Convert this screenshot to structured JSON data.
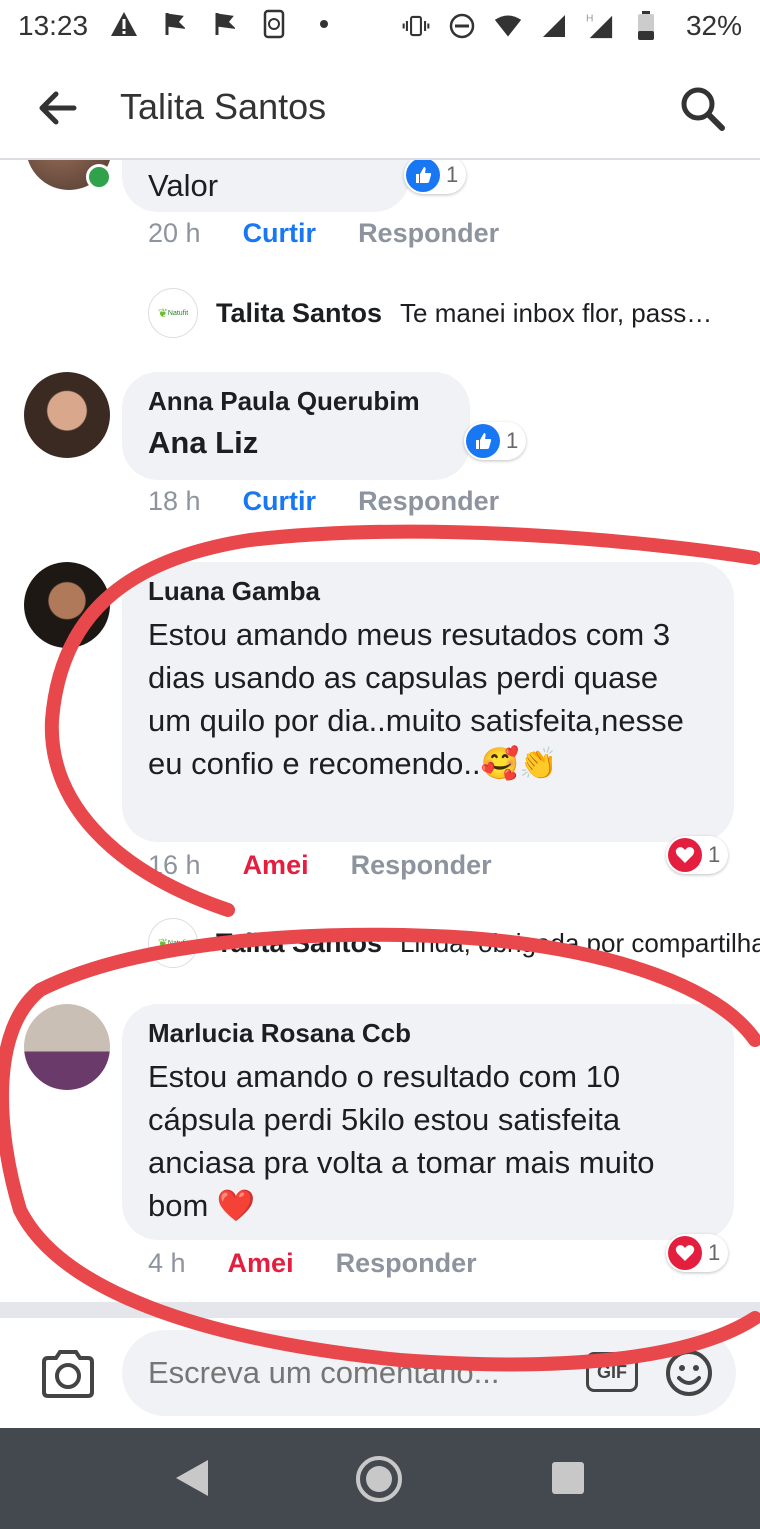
{
  "status_bar": {
    "time": "13:23",
    "battery": "32%"
  },
  "header": {
    "title": "Talita Santos"
  },
  "comments": [
    {
      "text": "Valor",
      "time": "20 h",
      "action": "Curtir",
      "reply": "Responder",
      "reaction_count": "1"
    },
    {
      "name": "Anna Paula Querubim",
      "text": "Ana Liz",
      "time": "18 h",
      "action": "Curtir",
      "reply": "Responder",
      "reaction_count": "1"
    },
    {
      "name": "Luana Gamba",
      "text": "Estou amando meus resutados com 3 dias usando as capsulas perdi quase um quilo por dia..muito satisfeita,nesse eu confio e recomendo..🥰👏",
      "time": "16 h",
      "action": "Amei",
      "reply": "Responder",
      "reaction_count": "1"
    },
    {
      "name": "Marlucia Rosana Ccb",
      "text": "Estou amando o resultado com 10 cápsula perdi 5kilo estou satisfeita anciasa pra volta a tomar mais muito bom ❤️",
      "time": "4 h",
      "action": "Amei",
      "reply": "Responder",
      "reaction_count": "1"
    }
  ],
  "replies": [
    {
      "name": "Talita Santos",
      "text": "Te manei inbox flor, pass…",
      "avatar_label": "Natufit"
    },
    {
      "name": "Talita Santos",
      "text": "Linda, obrigada por compartilhar…",
      "avatar_label": "Natufit"
    }
  ],
  "composer": {
    "placeholder": "Escreva um comentário..."
  },
  "colors": {
    "like_blue": "#1877f2",
    "love_red": "#e41e3f",
    "bubble_gray": "#f0f2f5",
    "annotation_red": "#e8474b"
  }
}
